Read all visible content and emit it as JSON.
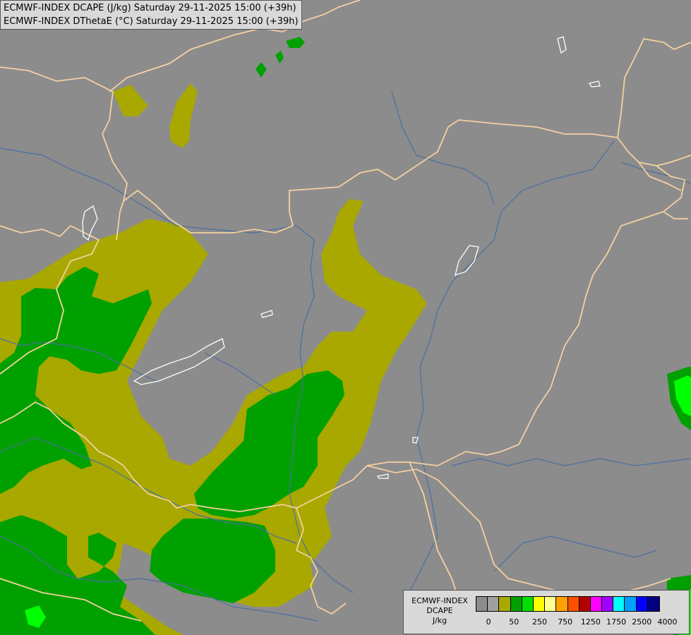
{
  "title": {
    "line1": "ECMWF-INDEX DCAPE (J/kg) Saturday 29-11-2025 15:00 (+39h)",
    "line2": "ECMWF-INDEX DThetaE (°C) Saturday 29-11-2025 15:00 (+39h)"
  },
  "legend": {
    "model": "ECMWF-INDEX",
    "field": "DCAPE",
    "unit": "J/kg",
    "colors": [
      "#8c8c8c",
      "#a0a0a0",
      "#a8a800",
      "#00a000",
      "#00e000",
      "#ffff00",
      "#ffff90",
      "#ffa000",
      "#ff5000",
      "#b00000",
      "#ff00ff",
      "#a000ff",
      "#00ffff",
      "#00a0ff",
      "#0000ff",
      "#000080"
    ],
    "ticks": [
      "0",
      "50",
      "250",
      "750",
      "1250",
      "1750",
      "2500",
      "4000"
    ]
  },
  "colors": {
    "background": "#8c8c8c",
    "olive": "#a8a800",
    "green": "#00a000",
    "bright_green": "#00ff00",
    "border": "#f5d0a0",
    "river": "#4a6fa0",
    "lake": "#ffffff"
  }
}
